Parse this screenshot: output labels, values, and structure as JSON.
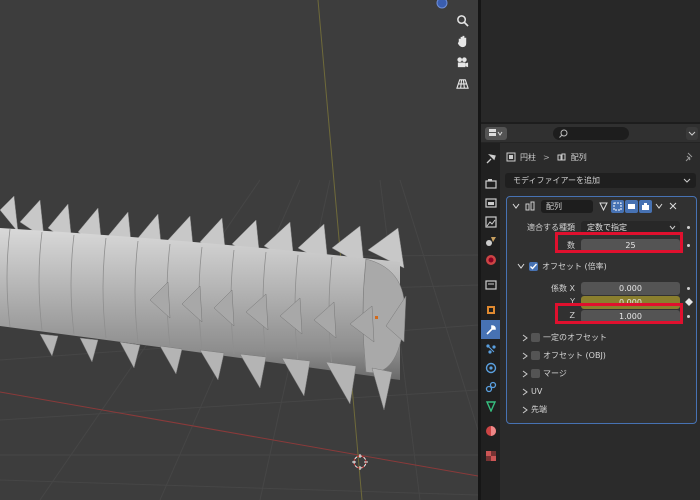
{
  "viewport": {
    "nav_icons": [
      "zoom-icon",
      "pan-hand-icon",
      "camera-icon",
      "grid-view-icon"
    ]
  },
  "properties": {
    "breadcrumb": {
      "object": "円柱",
      "separator": ">",
      "modifier": "配列"
    },
    "add_modifier_label": "モディファイアーを追加",
    "modifier": {
      "name": "配列",
      "fit_type_label": "適合する種類",
      "fit_type_value": "定数で指定",
      "count_label": "数",
      "count_value": "25",
      "relative_offset_label": "オフセット (倍率)",
      "relative_offset_enabled": true,
      "factor_x_label": "係数 X",
      "factor_x_value": "0.000",
      "factor_y_label": "Y",
      "factor_y_value": "0.000",
      "factor_z_label": "Z",
      "factor_z_value": "1.000",
      "subpanels": [
        {
          "label": "一定のオフセット",
          "checkbox": true
        },
        {
          "label": "オフセット (OBJ)",
          "checkbox": true
        },
        {
          "label": "マージ",
          "checkbox": true
        },
        {
          "label": "UV",
          "checkbox": false
        },
        {
          "label": "先端",
          "checkbox": false
        }
      ]
    }
  },
  "colors": {
    "accent": "#4772b3",
    "highlight": "#e0102e",
    "y_field_keyed": "#8a7f2e"
  }
}
